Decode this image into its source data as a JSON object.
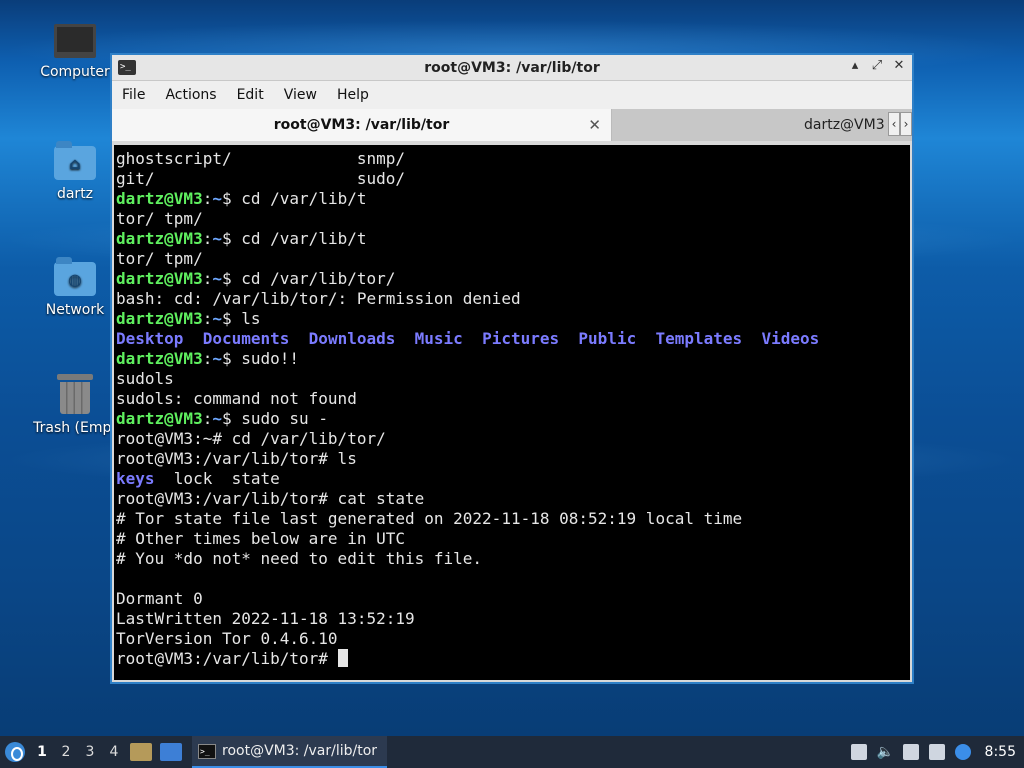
{
  "desktop": {
    "icons": [
      {
        "label": "Computer",
        "icon": "computer-icon"
      },
      {
        "label": "dartz",
        "icon": "home-folder-icon"
      },
      {
        "label": "Network",
        "icon": "network-folder-icon"
      },
      {
        "label": "Trash (Empt",
        "icon": "trash-icon"
      }
    ]
  },
  "window": {
    "title": "root@VM3: /var/lib/tor",
    "icon_glyph": ">_",
    "controls": {
      "minimize": "▴",
      "maximize": "⤢",
      "close": "✕"
    },
    "menu": [
      "File",
      "Actions",
      "Edit",
      "View",
      "Help"
    ],
    "tabs": [
      {
        "label": "root@VM3: /var/lib/tor",
        "active": true,
        "close": "✕"
      },
      {
        "label": "dartz@VM3",
        "active": false
      }
    ],
    "tab_nav": {
      "prev": "‹",
      "next": "›"
    }
  },
  "terminal": {
    "lines": [
      [
        {
          "t": "ghostscript/             snmp/",
          "c": "plain"
        }
      ],
      [
        {
          "t": "git/                     sudo/",
          "c": "plain"
        }
      ],
      [
        {
          "t": "dartz@VM3",
          "c": "user"
        },
        {
          "t": ":",
          "c": "plain"
        },
        {
          "t": "~",
          "c": "path"
        },
        {
          "t": "$ cd /var/lib/t",
          "c": "plain"
        }
      ],
      [
        {
          "t": "tor/ tpm/",
          "c": "plain"
        }
      ],
      [
        {
          "t": "dartz@VM3",
          "c": "user"
        },
        {
          "t": ":",
          "c": "plain"
        },
        {
          "t": "~",
          "c": "path"
        },
        {
          "t": "$ cd /var/lib/t",
          "c": "plain"
        }
      ],
      [
        {
          "t": "tor/ tpm/",
          "c": "plain"
        }
      ],
      [
        {
          "t": "dartz@VM3",
          "c": "user"
        },
        {
          "t": ":",
          "c": "plain"
        },
        {
          "t": "~",
          "c": "path"
        },
        {
          "t": "$ cd /var/lib/tor/",
          "c": "plain"
        }
      ],
      [
        {
          "t": "bash: cd: /var/lib/tor/: Permission denied",
          "c": "plain"
        }
      ],
      [
        {
          "t": "dartz@VM3",
          "c": "user"
        },
        {
          "t": ":",
          "c": "plain"
        },
        {
          "t": "~",
          "c": "path"
        },
        {
          "t": "$ ls",
          "c": "plain"
        }
      ],
      [
        {
          "t": "Desktop",
          "c": "dir"
        },
        {
          "t": "  ",
          "c": "plain"
        },
        {
          "t": "Documents",
          "c": "dir"
        },
        {
          "t": "  ",
          "c": "plain"
        },
        {
          "t": "Downloads",
          "c": "dir"
        },
        {
          "t": "  ",
          "c": "plain"
        },
        {
          "t": "Music",
          "c": "dir"
        },
        {
          "t": "  ",
          "c": "plain"
        },
        {
          "t": "Pictures",
          "c": "dir"
        },
        {
          "t": "  ",
          "c": "plain"
        },
        {
          "t": "Public",
          "c": "dir"
        },
        {
          "t": "  ",
          "c": "plain"
        },
        {
          "t": "Templates",
          "c": "dir"
        },
        {
          "t": "  ",
          "c": "plain"
        },
        {
          "t": "Videos",
          "c": "dir"
        }
      ],
      [
        {
          "t": "dartz@VM3",
          "c": "user"
        },
        {
          "t": ":",
          "c": "plain"
        },
        {
          "t": "~",
          "c": "path"
        },
        {
          "t": "$ sudo!!",
          "c": "plain"
        }
      ],
      [
        {
          "t": "sudols",
          "c": "plain"
        }
      ],
      [
        {
          "t": "sudols: command not found",
          "c": "plain"
        }
      ],
      [
        {
          "t": "dartz@VM3",
          "c": "user"
        },
        {
          "t": ":",
          "c": "plain"
        },
        {
          "t": "~",
          "c": "path"
        },
        {
          "t": "$ sudo su -",
          "c": "plain"
        }
      ],
      [
        {
          "t": "root@VM3:~# cd /var/lib/tor/",
          "c": "plain"
        }
      ],
      [
        {
          "t": "root@VM3:/var/lib/tor# ls",
          "c": "plain"
        }
      ],
      [
        {
          "t": "keys",
          "c": "dir"
        },
        {
          "t": "  lock  state",
          "c": "plain"
        }
      ],
      [
        {
          "t": "root@VM3:/var/lib/tor# cat state",
          "c": "plain"
        }
      ],
      [
        {
          "t": "# Tor state file last generated on 2022-11-18 08:52:19 local time",
          "c": "plain"
        }
      ],
      [
        {
          "t": "# Other times below are in UTC",
          "c": "plain"
        }
      ],
      [
        {
          "t": "# You *do not* need to edit this file.",
          "c": "plain"
        }
      ],
      [
        {
          "t": "",
          "c": "plain"
        }
      ],
      [
        {
          "t": "Dormant 0",
          "c": "plain"
        }
      ],
      [
        {
          "t": "LastWritten 2022-11-18 13:52:19",
          "c": "plain"
        }
      ],
      [
        {
          "t": "TorVersion Tor 0.4.6.10",
          "c": "plain"
        }
      ],
      [
        {
          "t": "root@VM3:/var/lib/tor# ",
          "c": "plain"
        },
        {
          "t": "",
          "c": "cursor"
        }
      ]
    ]
  },
  "taskbar": {
    "workspaces": [
      "1",
      "2",
      "3",
      "4"
    ],
    "active_workspace": "1",
    "task_label": "root@VM3: /var/lib/tor",
    "clock": "8:55"
  },
  "colors": {
    "prompt_user": "#5ff05f",
    "prompt_path": "#6fa8ff",
    "directory": "#7b7bff",
    "window_border": "#2f80c7"
  }
}
